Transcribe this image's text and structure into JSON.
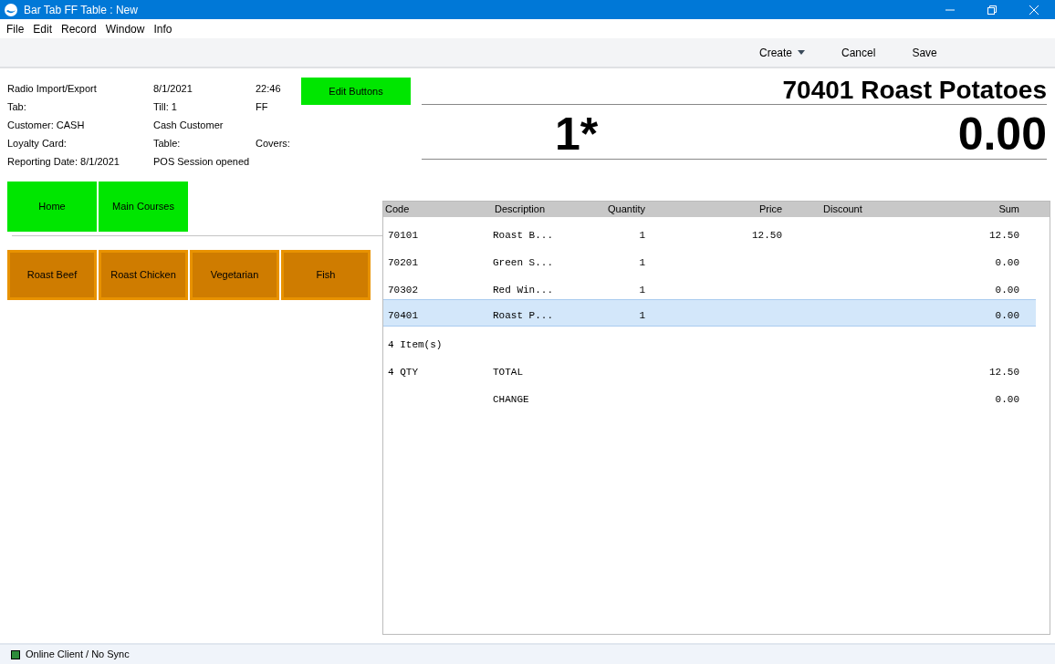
{
  "window": {
    "title": "Bar Tab FF Table : New"
  },
  "menu": [
    "File",
    "Edit",
    "Record",
    "Window",
    "Info"
  ],
  "toolbar": [
    {
      "label": "Create",
      "kind": "dropdown"
    },
    {
      "label": "Cancel",
      "kind": "plain"
    },
    {
      "label": "Save",
      "kind": "plain"
    }
  ],
  "info": [
    {
      "column_1": "Radio Import/Export",
      "column_2": "8/1/2021",
      "column_3": "22:46"
    },
    {
      "column_1": "Tab:",
      "column_2": "Till: 1",
      "column_3": "FF"
    },
    {
      "column_1": "Customer: CASH",
      "column_2": "Cash Customer"
    },
    {
      "column_1": "Loyalty Card:",
      "column_2": "Table:",
      "column_3": "Covers:"
    },
    {
      "column_1": "Reporting Date: 8/1/2021",
      "column_2": "POS Session opened"
    }
  ],
  "edit_button": "Edit Buttons",
  "nav_buttons": [
    "Home",
    "Main Courses"
  ],
  "item_buttons": [
    "Roast Beef",
    "Roast Chicken",
    "Vegetarian",
    "Fish"
  ],
  "display": {
    "item": "70401 Roast Potatoes",
    "quantity": "1*",
    "amount": "0.00"
  },
  "table": {
    "columns": [
      "Code",
      "Description",
      "Quantity",
      "Price",
      "Discount",
      "Sum"
    ],
    "rows": [
      {
        "cells": [
          "70101",
          "Roast B...",
          "1",
          "12.50",
          "",
          "12.50"
        ],
        "selected": false
      },
      {
        "cells": [
          "70201",
          "Green S...",
          "1",
          "",
          "",
          "0.00"
        ],
        "selected": false
      },
      {
        "cells": [
          "70302",
          "Red Win...",
          "1",
          "",
          "",
          "0.00"
        ],
        "selected": false
      },
      {
        "cells": [
          "70401",
          "Roast P...",
          "1",
          "",
          "",
          "0.00"
        ],
        "selected": true
      },
      {
        "cells": [
          "4 Item(s)"
        ],
        "selected": false
      },
      {
        "cells": [
          "4 QTY",
          "TOTAL",
          "",
          "",
          "",
          "12.50"
        ],
        "selected": false
      },
      {
        "cells": [
          "",
          "CHANGE",
          "",
          "",
          "",
          "0.00"
        ],
        "selected": false
      }
    ]
  },
  "status_bar": {
    "text": "Online Client / No Sync",
    "color": "#2e8b3a"
  }
}
